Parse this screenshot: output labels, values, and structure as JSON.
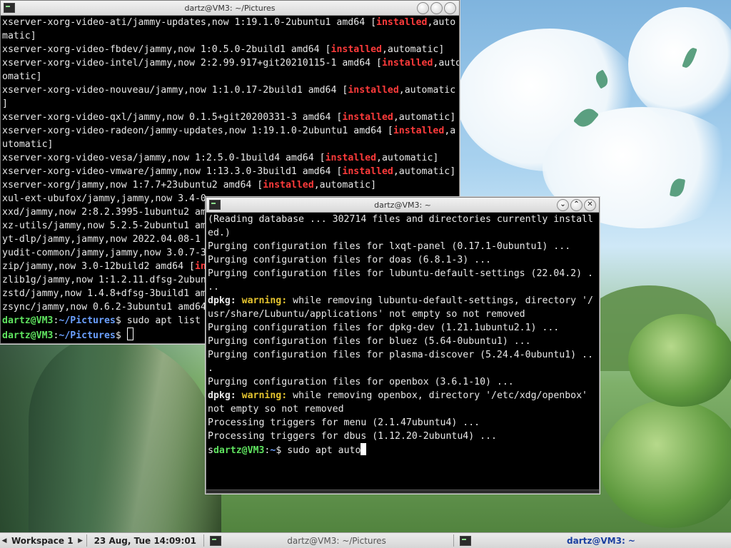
{
  "colors": {
    "installed": "#ff3b3b",
    "prompt_user": "#5fe35f",
    "prompt_path": "#6ba0ff",
    "warning": "#e5c42f",
    "terminal_bg": "#000000",
    "terminal_fg": "#e8e8e8"
  },
  "window_back": {
    "title": "dartz@VM3: ~/Pictures",
    "app_icon": "terminal-icon",
    "buttons": [
      "minimize",
      "maximize",
      "close"
    ],
    "lines": [
      [
        {
          "t": "xserver-xorg-video-ati/jammy-updates,now 1:19.1.0-2ubuntu1 amd64 ["
        },
        {
          "t": "installed",
          "c": "red"
        },
        {
          "t": ",auto"
        }
      ],
      [
        {
          "t": "matic]"
        }
      ],
      [
        {
          "t": "xserver-xorg-video-fbdev/jammy,now 1:0.5.0-2build1 amd64 ["
        },
        {
          "t": "installed",
          "c": "red"
        },
        {
          "t": ",automatic]"
        }
      ],
      [
        {
          "t": "xserver-xorg-video-intel/jammy,now 2:2.99.917+git20210115-1 amd64 ["
        },
        {
          "t": "installed",
          "c": "red"
        },
        {
          "t": ",auto"
        }
      ],
      [
        {
          "t": "omatic]"
        }
      ],
      [
        {
          "t": "xserver-xorg-video-nouveau/jammy,now 1:1.0.17-2build1 amd64 ["
        },
        {
          "t": "installed",
          "c": "red"
        },
        {
          "t": ",automatic"
        }
      ],
      [
        {
          "t": "]"
        }
      ],
      [
        {
          "t": "xserver-xorg-video-qxl/jammy,now 0.1.5+git20200331-3 amd64 ["
        },
        {
          "t": "installed",
          "c": "red"
        },
        {
          "t": ",automatic]"
        }
      ],
      [
        {
          "t": "xserver-xorg-video-radeon/jammy-updates,now 1:19.1.0-2ubuntu1 amd64 ["
        },
        {
          "t": "installed",
          "c": "red"
        },
        {
          "t": ",a"
        }
      ],
      [
        {
          "t": "utomatic]"
        }
      ],
      [
        {
          "t": "xserver-xorg-video-vesa/jammy,now 1:2.5.0-1build4 amd64 ["
        },
        {
          "t": "installed",
          "c": "red"
        },
        {
          "t": ",automatic]"
        }
      ],
      [
        {
          "t": "xserver-xorg-video-vmware/jammy,now 1:13.3.0-3build1 amd64 ["
        },
        {
          "t": "installed",
          "c": "red"
        },
        {
          "t": ",automatic]"
        }
      ],
      [
        {
          "t": "xserver-xorg/jammy,now 1:7.7+23ubuntu2 amd64 ["
        },
        {
          "t": "installed",
          "c": "red"
        },
        {
          "t": ",automatic]"
        }
      ],
      [
        {
          "t": "xul-ext-ubufox/jammy,jammy,now 3.4-0"
        }
      ],
      [
        {
          "t": "xxd/jammy,now 2:8.2.3995-1ubuntu2 am"
        }
      ],
      [
        {
          "t": "xz-utils/jammy,now 5.2.5-2ubuntu1 am"
        }
      ],
      [
        {
          "t": "yt-dlp/jammy,jammy,now 2022.04.08-1"
        }
      ],
      [
        {
          "t": "yudit-common/jammy,jammy,now 3.0.7-3"
        }
      ],
      [
        {
          "t": "zip/jammy,now 3.0-12build2 amd64 ["
        },
        {
          "t": "in",
          "c": "red"
        }
      ],
      [
        {
          "t": "zlib1g/jammy,now 1:1.2.11.dfsg-2ubun"
        }
      ],
      [
        {
          "t": "zstd/jammy,now 1.4.8+dfsg-3build1 am"
        }
      ],
      [
        {
          "t": "zsync/jammy,now 0.6.2-3ubuntu1 amd64"
        }
      ],
      [
        {
          "t": "dartz@VM3",
          "c": "green"
        },
        {
          "t": ":"
        },
        {
          "t": "~/Pictures",
          "c": "blue"
        },
        {
          "t": "$ sudo apt list"
        }
      ],
      [
        {
          "t": "dartz@VM3",
          "c": "green"
        },
        {
          "t": ":"
        },
        {
          "t": "~/Pictures",
          "c": "blue"
        },
        {
          "t": "$ "
        },
        {
          "cursor": "hollow"
        }
      ]
    ]
  },
  "window_front": {
    "title": "dartz@VM3: ~",
    "app_icon": "terminal-icon",
    "buttons": [
      "minimize",
      "maximize",
      "close"
    ],
    "lines": [
      [
        {
          "t": "(Reading database ... 302714 files and directories currently install"
        }
      ],
      [
        {
          "t": "ed.)"
        }
      ],
      [
        {
          "t": "Purging configuration files for lxqt-panel (0.17.1-0ubuntu1) ..."
        }
      ],
      [
        {
          "t": "Purging configuration files for doas (6.8.1-3) ..."
        }
      ],
      [
        {
          "t": "Purging configuration files for lubuntu-default-settings (22.04.2) ."
        }
      ],
      [
        {
          "t": ".."
        }
      ],
      [
        {
          "t": "dpkg:",
          "c": "bold"
        },
        {
          "t": " "
        },
        {
          "t": "warning:",
          "c": "yellow"
        },
        {
          "t": " while removing lubuntu-default-settings, directory '/"
        }
      ],
      [
        {
          "t": "usr/share/Lubuntu/applications' not empty so not removed"
        }
      ],
      [
        {
          "t": "Purging configuration files for dpkg-dev (1.21.1ubuntu2.1) ..."
        }
      ],
      [
        {
          "t": "Purging configuration files for bluez (5.64-0ubuntu1) ..."
        }
      ],
      [
        {
          "t": "Purging configuration files for plasma-discover (5.24.4-0ubuntu1) .."
        }
      ],
      [
        {
          "t": "."
        }
      ],
      [
        {
          "t": "Purging configuration files for openbox (3.6.1-10) ..."
        }
      ],
      [
        {
          "t": "dpkg:",
          "c": "bold"
        },
        {
          "t": " "
        },
        {
          "t": "warning:",
          "c": "yellow"
        },
        {
          "t": " while removing openbox, directory '/etc/xdg/openbox'"
        }
      ],
      [
        {
          "t": "not empty so not removed"
        }
      ],
      [
        {
          "t": "Processing triggers for menu (2.1.47ubuntu4) ..."
        }
      ],
      [
        {
          "t": "Processing triggers for dbus (1.12.20-2ubuntu4) ..."
        }
      ],
      [
        {
          "t": "s"
        },
        {
          "t": "dartz@VM3",
          "c": "green"
        },
        {
          "t": ":"
        },
        {
          "t": "~",
          "c": "blue"
        },
        {
          "t": "$ sudo apt auto"
        },
        {
          "cursor": "solid"
        }
      ]
    ]
  },
  "taskbar": {
    "workspace_label": "Workspace 1",
    "clock": "23 Aug, Tue 14:09:01",
    "tasks": [
      {
        "label": "dartz@VM3: ~/Pictures",
        "active": false
      },
      {
        "label": "dartz@VM3: ~",
        "active": true
      }
    ]
  }
}
